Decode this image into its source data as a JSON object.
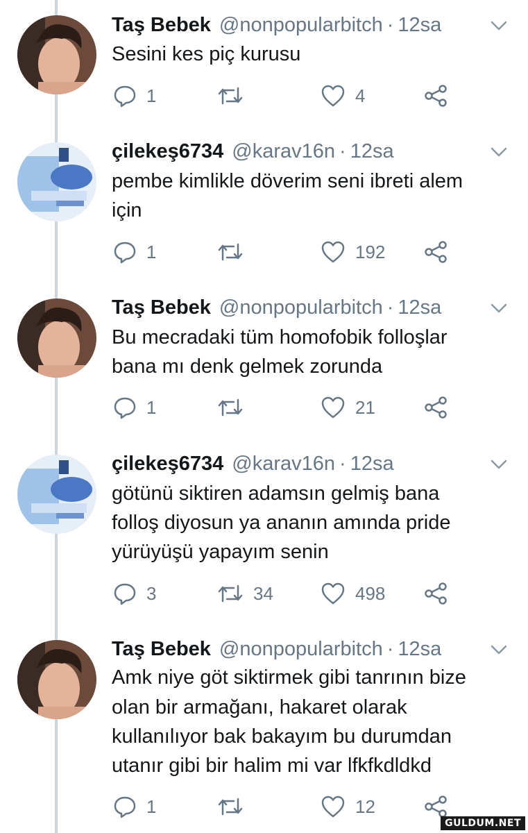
{
  "colors": {
    "text": "#14171a",
    "muted": "#657786",
    "thread_line": "#ccd6dd",
    "background": "#ffffff"
  },
  "icons": {
    "reply": "reply-icon",
    "retweet": "retweet-icon",
    "like": "heart-icon",
    "share": "share-icon",
    "more": "chevron-down-icon"
  },
  "tweets": [
    {
      "name": "Taş Bebek",
      "handle": "@nonpopularbitch",
      "separator": "·",
      "time": "12sa",
      "lines": [
        "Sesini kes piç kurusu"
      ],
      "replies": "1",
      "retweets": "",
      "likes": "4"
    },
    {
      "name": "çilekeş6734",
      "handle": "@karav16n",
      "separator": "·",
      "time": "12sa",
      "lines": [
        "pembe kimlikle döverim seni ibreti alem",
        "için"
      ],
      "replies": "1",
      "retweets": "",
      "likes": "192"
    },
    {
      "name": "Taş Bebek",
      "handle": "@nonpopularbitch",
      "separator": "·",
      "time": "12sa",
      "lines": [
        "Bu mecradaki tüm homofobik  folloşlar",
        "bana mı denk gelmek zorunda"
      ],
      "replies": "1",
      "retweets": "",
      "likes": "21"
    },
    {
      "name": "çilekeş6734",
      "handle": "@karav16n",
      "separator": "·",
      "time": "12sa",
      "lines": [
        "götünü siktiren adamsın gelmiş bana",
        "folloş diyosun ya ananın amında pride",
        "yürüyüşü yapayım senin"
      ],
      "replies": "3",
      "retweets": "34",
      "likes": "498"
    },
    {
      "name": "Taş Bebek",
      "handle": "@nonpopularbitch",
      "separator": "·",
      "time": "12sa",
      "lines": [
        "Amk niye göt siktirmek gibi tanrının bize",
        "olan bir armağanı, hakaret olarak",
        "kullanılıyor bak bakayım bu durumdan",
        "utanır gibi bir halim mi var lfkfkdldkd"
      ],
      "replies": "1",
      "retweets": "",
      "likes": "12"
    }
  ],
  "watermark": "GULDUM.NET"
}
